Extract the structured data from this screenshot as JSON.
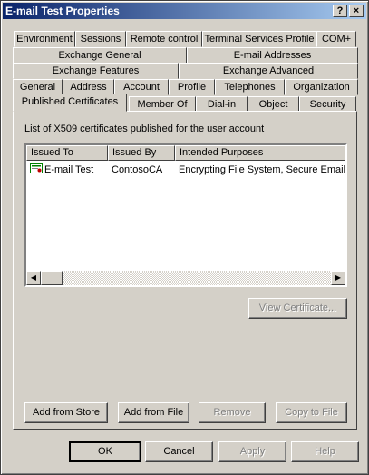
{
  "window": {
    "title": "E-mail Test Properties",
    "help_glyph": "?",
    "close_glyph": "×"
  },
  "tabs": {
    "row1": [
      {
        "label": "Environment"
      },
      {
        "label": "Sessions"
      },
      {
        "label": "Remote control"
      },
      {
        "label": "Terminal Services Profile"
      },
      {
        "label": "COM+"
      }
    ],
    "row2": [
      {
        "label": "Exchange General"
      },
      {
        "label": "E-mail Addresses"
      }
    ],
    "row3": [
      {
        "label": "Exchange Features"
      },
      {
        "label": "Exchange Advanced"
      }
    ],
    "row4": [
      {
        "label": "General"
      },
      {
        "label": "Address"
      },
      {
        "label": "Account"
      },
      {
        "label": "Profile"
      },
      {
        "label": "Telephones"
      },
      {
        "label": "Organization"
      }
    ],
    "row5": [
      {
        "label": "Published Certificates"
      },
      {
        "label": "Member Of"
      },
      {
        "label": "Dial-in"
      },
      {
        "label": "Object"
      },
      {
        "label": "Security"
      }
    ]
  },
  "panel": {
    "list_label": "List of X509 certificates published for the user account",
    "columns": [
      "Issued To",
      "Issued By",
      "Intended Purposes"
    ],
    "rows": [
      {
        "issued_to": "E-mail Test",
        "issued_by": "ContosoCA",
        "purposes": "Encrypting File System, Secure Email..."
      }
    ],
    "view_certificate": "View Certificate...",
    "add_from_store": "Add from Store",
    "add_from_file": "Add from File",
    "remove": "Remove",
    "copy_to_file": "Copy to File"
  },
  "footer": {
    "ok": "OK",
    "cancel": "Cancel",
    "apply": "Apply",
    "help": "Help"
  }
}
